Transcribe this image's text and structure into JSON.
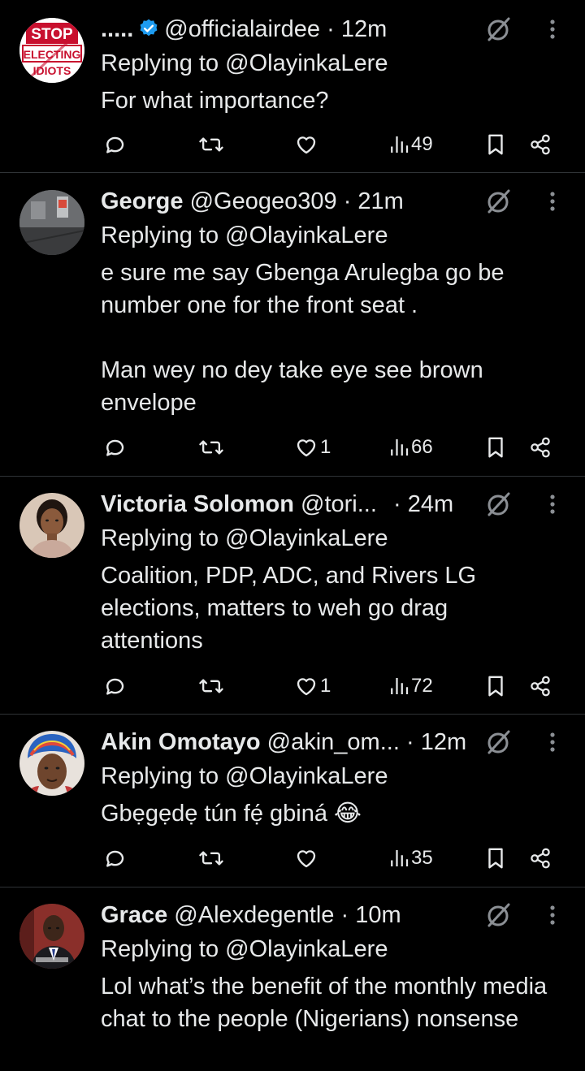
{
  "tweets": [
    {
      "name": ".....",
      "verified": true,
      "handle": "@officialairdee",
      "dot": "·",
      "time": "12m",
      "replying": "Replying to @OlayinkaLere",
      "text": "For what importance?",
      "likes": "",
      "views": "49",
      "avatar_icon": "stop-sign-avatar"
    },
    {
      "name": "George",
      "verified": false,
      "handle": "@Geogeo309",
      "dot": "·",
      "time": "21m",
      "replying": "Replying to @OlayinkaLere",
      "text": "e sure me say Gbenga Arulegba go be number one for the front seat .\n\nMan wey no dey take eye see brown envelope",
      "likes": "1",
      "views": "66",
      "avatar_icon": "room-photo-avatar"
    },
    {
      "name": "Victoria Solomon",
      "verified": false,
      "handle": "@tori...",
      "dot": "·",
      "time": "24m",
      "replying": "Replying to @OlayinkaLere",
      "text": "Coalition, PDP, ADC, and Rivers LG elections, matters to weh go drag attentions",
      "likes": "1",
      "views": "72",
      "avatar_icon": "woman-portrait-avatar"
    },
    {
      "name": "Akin Omotayo",
      "verified": false,
      "handle": "@akin_om...",
      "dot": "·",
      "time": "12m",
      "replying": "Replying to @OlayinkaLere",
      "text": "Gbẹgẹdẹ tún fẹ́ gbiná 😂",
      "likes": "",
      "views": "35",
      "avatar_icon": "woman-headwrap-avatar"
    },
    {
      "name": "Grace",
      "verified": false,
      "handle": "@Alexdegentle",
      "dot": "·",
      "time": "10m",
      "replying": "Replying to @OlayinkaLere",
      "text": "Lol what’s the benefit of the monthly media chat to the people (Nigerians) nonsense",
      "likes": "",
      "views": "",
      "avatar_icon": "man-suit-avatar"
    }
  ],
  "colors": {
    "background": "#000000",
    "text": "#e7e9ea",
    "icon": "#e7e9ea",
    "divider": "#2f3336",
    "verified": "#1d9bf0"
  },
  "avatar_text": {
    "stop": "STOP",
    "electing": "ELECTING",
    "idiots": "IDIOTS"
  }
}
